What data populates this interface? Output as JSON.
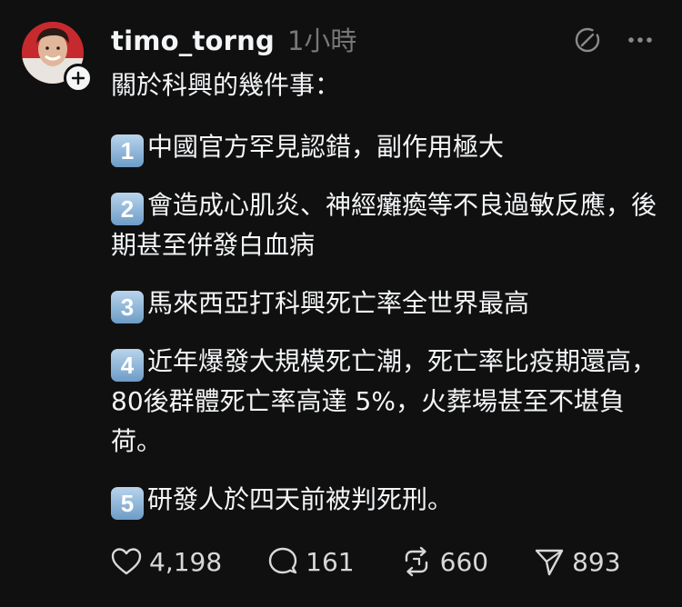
{
  "post": {
    "username": "timo_torng",
    "time": "1小時",
    "intro": "關於科興的幾件事：",
    "items": [
      {
        "num": "1",
        "text": "中國官方罕見認錯，副作用極大"
      },
      {
        "num": "2",
        "text": "會造成心肌炎、神經癱瘓等不良過敏反應，後期甚至併發白血病"
      },
      {
        "num": "3",
        "text": "馬來西亞打科興死亡率全世界最高"
      },
      {
        "num": "4",
        "text": "近年爆發大規模死亡潮，死亡率比疫期還高，80後群體死亡率高達 5%，火葬場甚至不堪負荷。"
      },
      {
        "num": "5",
        "text": "研發人於四天前被判死刑。"
      }
    ]
  },
  "actions": {
    "likes": "4,198",
    "replies": "161",
    "reposts": "660",
    "shares": "893"
  },
  "icons": {
    "avatar_plus": "plus-icon",
    "translate": "translate-icon",
    "more": "more-icon",
    "like": "heart-icon",
    "reply": "comment-icon",
    "repost": "repost-icon",
    "share": "send-icon"
  },
  "colors": {
    "background": "#101010",
    "text": "#f3f5f7",
    "muted": "#777777",
    "badge": "#8fb5d9"
  }
}
